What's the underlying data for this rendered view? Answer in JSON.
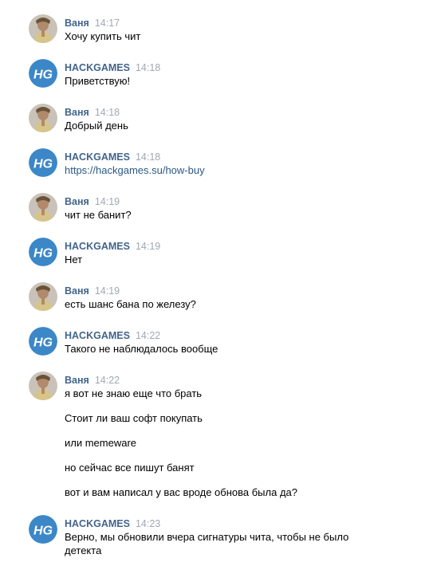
{
  "messages": [
    {
      "author": "Ваня",
      "avatar": "user-avatar",
      "time": "14:17",
      "lines": [
        "Хочу купить чит"
      ]
    },
    {
      "author": "HACKGAMES",
      "avatar": "hg-logo-avatar",
      "avatar_text": "HG",
      "time": "14:18",
      "lines": [
        "Приветствую!"
      ]
    },
    {
      "author": "Ваня",
      "avatar": "user-avatar",
      "time": "14:18",
      "lines": [
        "Добрый день"
      ]
    },
    {
      "author": "HACKGAMES",
      "avatar": "hg-logo-avatar",
      "avatar_text": "HG",
      "time": "14:18",
      "lines": [
        "https://hackgames.su/how-buy"
      ]
    },
    {
      "author": "Ваня",
      "avatar": "user-avatar",
      "time": "14:19",
      "lines": [
        "чит не банит?"
      ]
    },
    {
      "author": "HACKGAMES",
      "avatar": "hg-logo-avatar",
      "avatar_text": "HG",
      "time": "14:19",
      "lines": [
        "Нет"
      ]
    },
    {
      "author": "Ваня",
      "avatar": "user-avatar",
      "time": "14:19",
      "lines": [
        "есть шанс бана по железу?"
      ]
    },
    {
      "author": "HACKGAMES",
      "avatar": "hg-logo-avatar",
      "avatar_text": "HG",
      "time": "14:22",
      "lines": [
        "Такого не наблюдалось вообще"
      ]
    },
    {
      "author": "Ваня",
      "avatar": "user-avatar",
      "time": "14:22",
      "lines": [
        "я вот не знаю еще что брать",
        "Стоит ли ваш софт покупать",
        "или memeware",
        "но сейчас все пишут банят",
        "вот и вам написал у вас вроде обнова была да?"
      ]
    },
    {
      "author": "HACKGAMES",
      "avatar": "hg-logo-avatar",
      "avatar_text": "HG",
      "time": "14:23",
      "lines": [
        "Верно, мы обновили вчера сигнатуры чита, чтобы не было",
        "детекта"
      ]
    }
  ],
  "colors": {
    "author": "#42648b",
    "time": "#a0a8b2",
    "link": "#2a5885",
    "hg_avatar_bg": "#3b87c8"
  }
}
